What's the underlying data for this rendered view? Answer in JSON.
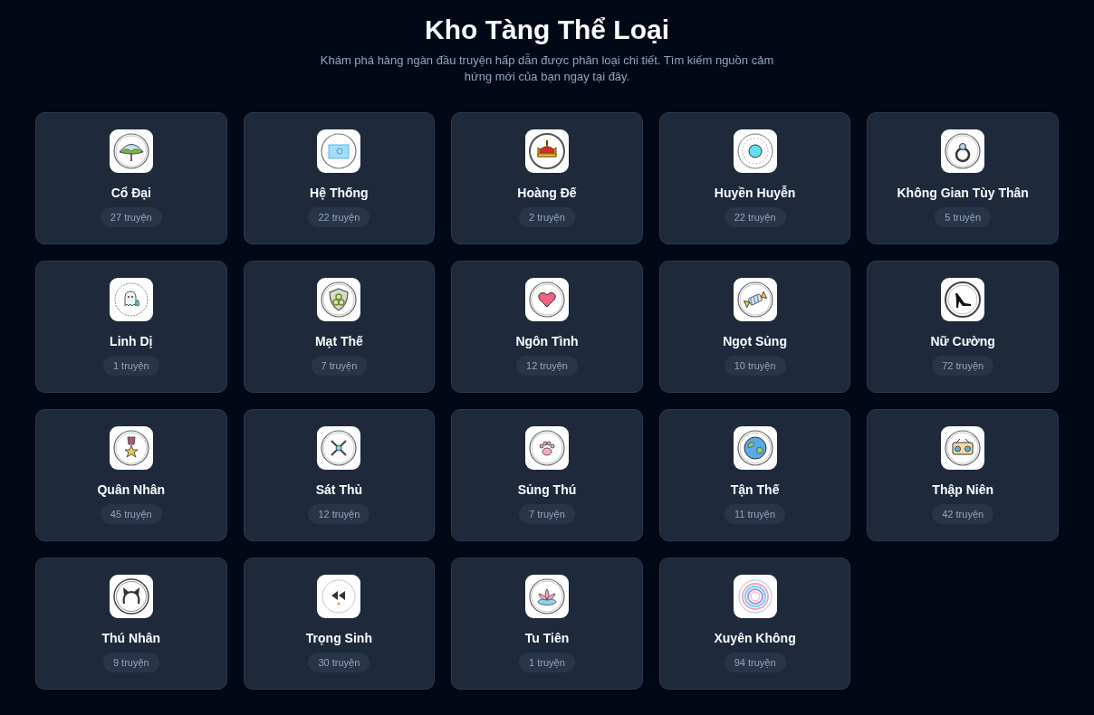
{
  "header": {
    "title": "Kho Tàng Thể Loại",
    "subtitle": "Khám phá hàng ngàn đầu truyện hấp dẫn được phân loại chi tiết. Tìm kiếm nguồn cảm hứng mới của bạn ngay tại đây."
  },
  "genres": [
    {
      "name": "Cổ Đại",
      "count": "27 truyện"
    },
    {
      "name": "Hệ Thống",
      "count": "22 truyện"
    },
    {
      "name": "Hoàng Đế",
      "count": "2 truyện"
    },
    {
      "name": "Huyền Huyễn",
      "count": "22 truyện"
    },
    {
      "name": "Không Gian Tùy Thân",
      "count": "5 truyện"
    },
    {
      "name": "Linh Dị",
      "count": "1 truyện"
    },
    {
      "name": "Mạt Thế",
      "count": "7 truyện"
    },
    {
      "name": "Ngôn Tình",
      "count": "12 truyện"
    },
    {
      "name": "Ngọt Sủng",
      "count": "10 truyện"
    },
    {
      "name": "Nữ Cường",
      "count": "72 truyện"
    },
    {
      "name": "Quân Nhân",
      "count": "45 truyện"
    },
    {
      "name": "Sát Thủ",
      "count": "12 truyện"
    },
    {
      "name": "Sủng Thú",
      "count": "7 truyện"
    },
    {
      "name": "Tận Thế",
      "count": "11 truyện"
    },
    {
      "name": "Thập Niên",
      "count": "42 truyện"
    },
    {
      "name": "Thú Nhân",
      "count": "9 truyện"
    },
    {
      "name": "Trọng Sinh",
      "count": "30 truyện"
    },
    {
      "name": "Tu Tiên",
      "count": "1 truyện"
    },
    {
      "name": "Xuyên Không",
      "count": "94 truyện"
    }
  ]
}
